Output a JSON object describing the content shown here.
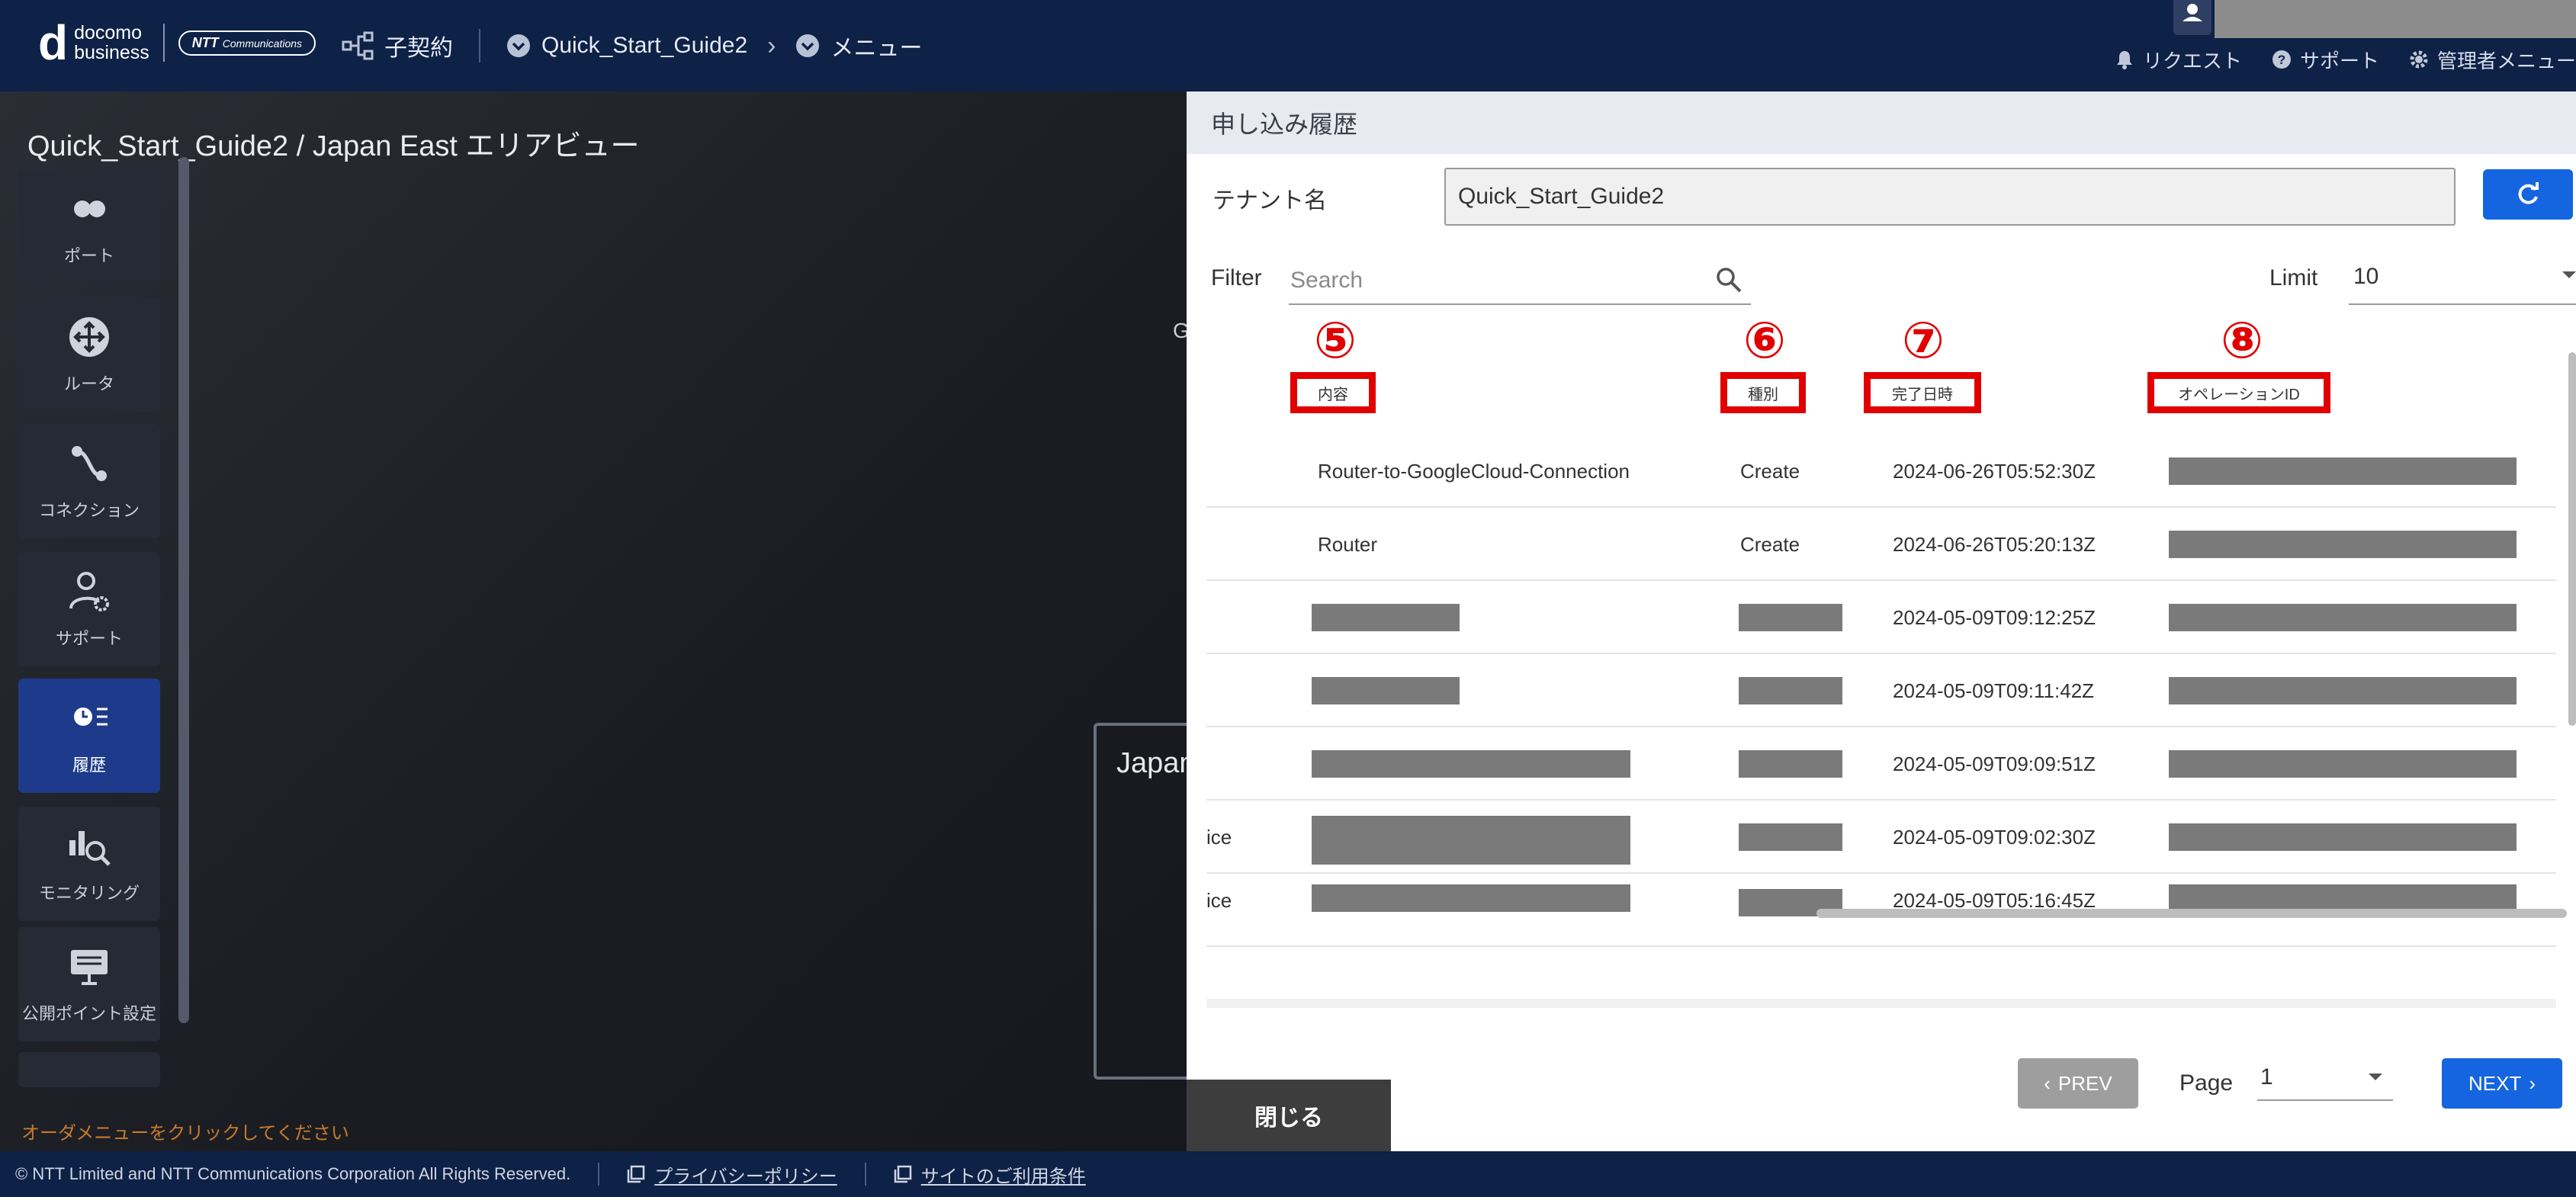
{
  "header": {
    "brand_line1": "docomo",
    "brand_line2": "business",
    "ntt_logo": "NTT",
    "ntt_logo_sub": "Communications",
    "crumb_contract": "子契約",
    "crumb_tenant": "Quick_Start_Guide2",
    "crumb_menu": "メニュー",
    "request": "リクエスト",
    "support": "サポート",
    "admin_menu": "管理者メニュー"
  },
  "workspace": {
    "title": "Quick_Start_Guide2 / Japan East エリアビュー",
    "ghost_card_text": "Japan",
    "ghost_letter": "G",
    "hint": "オーダメニューをクリックしてください"
  },
  "sidebar": {
    "items": [
      {
        "label": "ポート",
        "icon": "port-icon"
      },
      {
        "label": "ルータ",
        "icon": "router-icon"
      },
      {
        "label": "コネクション",
        "icon": "connection-icon"
      },
      {
        "label": "サポート",
        "icon": "support-user-icon"
      },
      {
        "label": "履歴",
        "icon": "history-icon",
        "active": true
      },
      {
        "label": "モニタリング",
        "icon": "monitoring-icon"
      },
      {
        "label": "公開ポイント設定",
        "icon": "public-point-icon"
      }
    ]
  },
  "panel": {
    "title": "申し込み履歴",
    "tenant_label": "テナント名",
    "tenant_value": "Quick_Start_Guide2",
    "filter_label": "Filter",
    "search_placeholder": "Search",
    "limit_label": "Limit",
    "limit_value": "10",
    "annotations": [
      {
        "num": "⑤",
        "label": "内容"
      },
      {
        "num": "⑥",
        "label": "種別"
      },
      {
        "num": "⑦",
        "label": "完了日時"
      },
      {
        "num": "⑧",
        "label": "オペレーションID"
      }
    ],
    "rows": [
      {
        "left": "",
        "content": "Router-to-GoogleCloud-Connection",
        "type": "Create",
        "date": "2024-06-26T05:52:30Z"
      },
      {
        "left": "",
        "content": "Router",
        "type": "Create",
        "date": "2024-06-26T05:20:13Z"
      },
      {
        "left": "",
        "content": "",
        "type": "",
        "date": "2024-05-09T09:12:25Z"
      },
      {
        "left": "",
        "content": "",
        "type": "",
        "date": "2024-05-09T09:11:42Z"
      },
      {
        "left": "",
        "content": "",
        "type": "",
        "date": "2024-05-09T09:09:51Z"
      },
      {
        "left": "ice",
        "content": "",
        "type": "",
        "date": "2024-05-09T09:02:30Z"
      },
      {
        "left": "ice",
        "content": "",
        "type": "",
        "date": "2024-05-09T05:16:45Z"
      }
    ],
    "prev": "PREV",
    "page_label": "Page",
    "page_value": "1",
    "next": "NEXT",
    "close": "閉じる"
  },
  "footer": {
    "copyright": "© NTT Limited and NTT Communications Corporation All Rights Reserved.",
    "privacy": "プライバシーポリシー",
    "terms": "サイトのご利用条件"
  },
  "colors": {
    "header_bg": "#0e2146",
    "primary": "#1565e0",
    "annotation": "#e00000",
    "redaction": "#7a7a7a"
  }
}
